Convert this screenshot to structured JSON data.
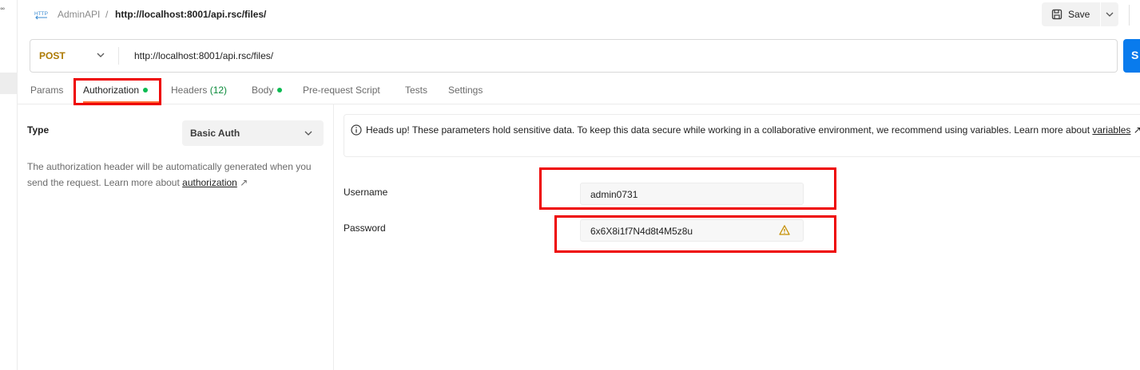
{
  "header": {
    "method_icon_text": "HTTP",
    "collection": "AdminAPI",
    "separator": "/",
    "request_name": "http://localhost:8001/api.rsc/files/",
    "save_label": "Save"
  },
  "request": {
    "method": "POST",
    "url": "http://localhost:8001/api.rsc/files/",
    "send_label": "S"
  },
  "tabs": [
    {
      "label": "Params"
    },
    {
      "label": "Authorization",
      "dot": true
    },
    {
      "label": "Headers",
      "count": "(12)"
    },
    {
      "label": "Body",
      "dot": true
    },
    {
      "label": "Pre-request Script"
    },
    {
      "label": "Tests"
    },
    {
      "label": "Settings"
    }
  ],
  "auth": {
    "type_label": "Type",
    "type_value": "Basic Auth",
    "description_prefix": "The authorization header will be automatically generated when you send the request. Learn more about",
    "description_link": "authorization",
    "link_arrow": "↗"
  },
  "notice": {
    "text": "Heads up! These parameters hold sensitive data. To keep this data secure while working in a collaborative environment, we recommend using variables. Learn more about",
    "link": "variables",
    "link_arrow": "↗"
  },
  "fields": {
    "username_label": "Username",
    "username_value": "admin0731",
    "password_label": "Password",
    "password_value": "6x6X8i1f7N4d8t4M5z8u"
  },
  "colors": {
    "method_post": "#ad7a03",
    "send_button": "#097bed",
    "active_tab_underline": "#ff6c37",
    "status_dot": "#0cbb52",
    "highlight": "#ee0000"
  }
}
